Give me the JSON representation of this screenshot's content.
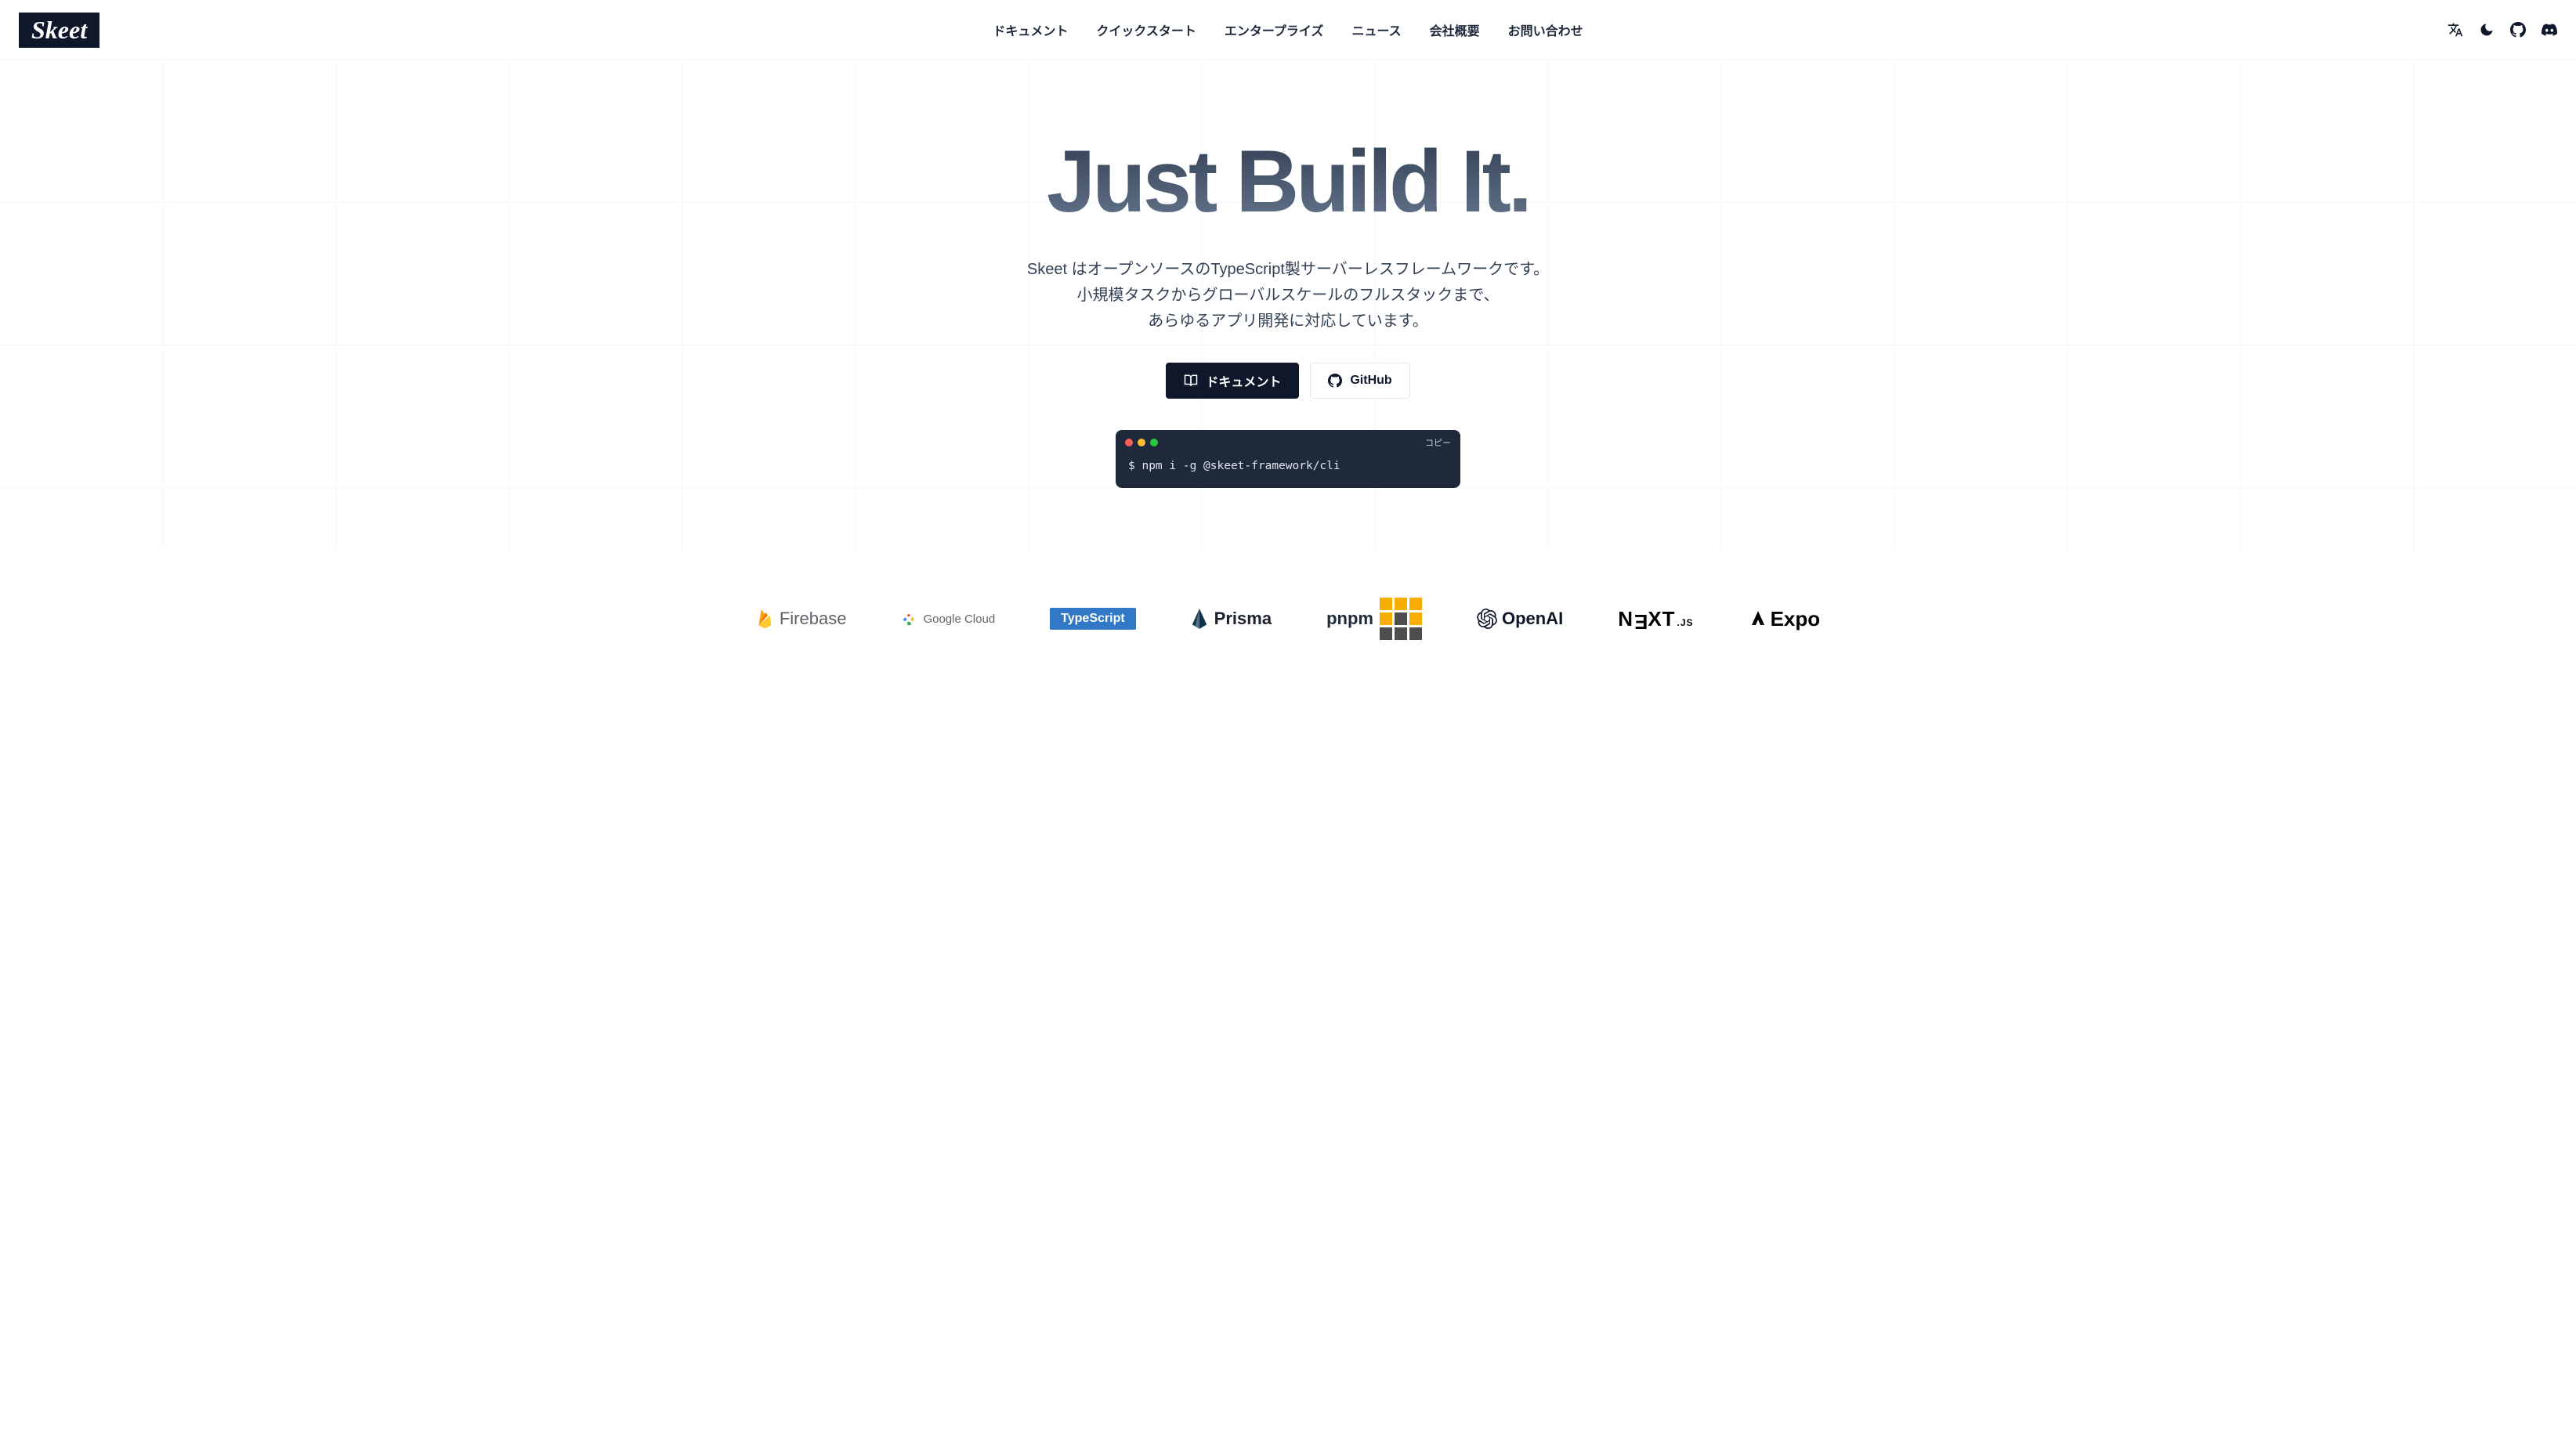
{
  "header": {
    "logo": "Skeet",
    "nav": {
      "docs": "ドキュメント",
      "quickstart": "クイックスタート",
      "enterprise": "エンタープライズ",
      "news": "ニュース",
      "company": "会社概要",
      "contact": "お問い合わせ"
    }
  },
  "hero": {
    "title": "Just Build It.",
    "desc_line1": "Skeet はオープンソースのTypeScript製サーバーレスフレームワークです。",
    "desc_line2": "小規模タスクからグローバルスケールのフルスタックまで、",
    "desc_line3": "あらゆるアプリ開発に対応しています。",
    "cta_primary": "ドキュメント",
    "cta_secondary": "GitHub"
  },
  "terminal": {
    "copy_label": "コピー",
    "command": "$ npm i -g @skeet-framework/cli"
  },
  "logos": {
    "firebase": "Firebase",
    "gcloud": "Google Cloud",
    "typescript_prefix": "Type",
    "typescript_suffix": "Script",
    "prisma": "Prisma",
    "pnpm": "pnpm",
    "openai": "OpenAI",
    "next_prefix": "N",
    "next_rest": "XT",
    "next_js": ".JS",
    "expo": "Expo"
  }
}
